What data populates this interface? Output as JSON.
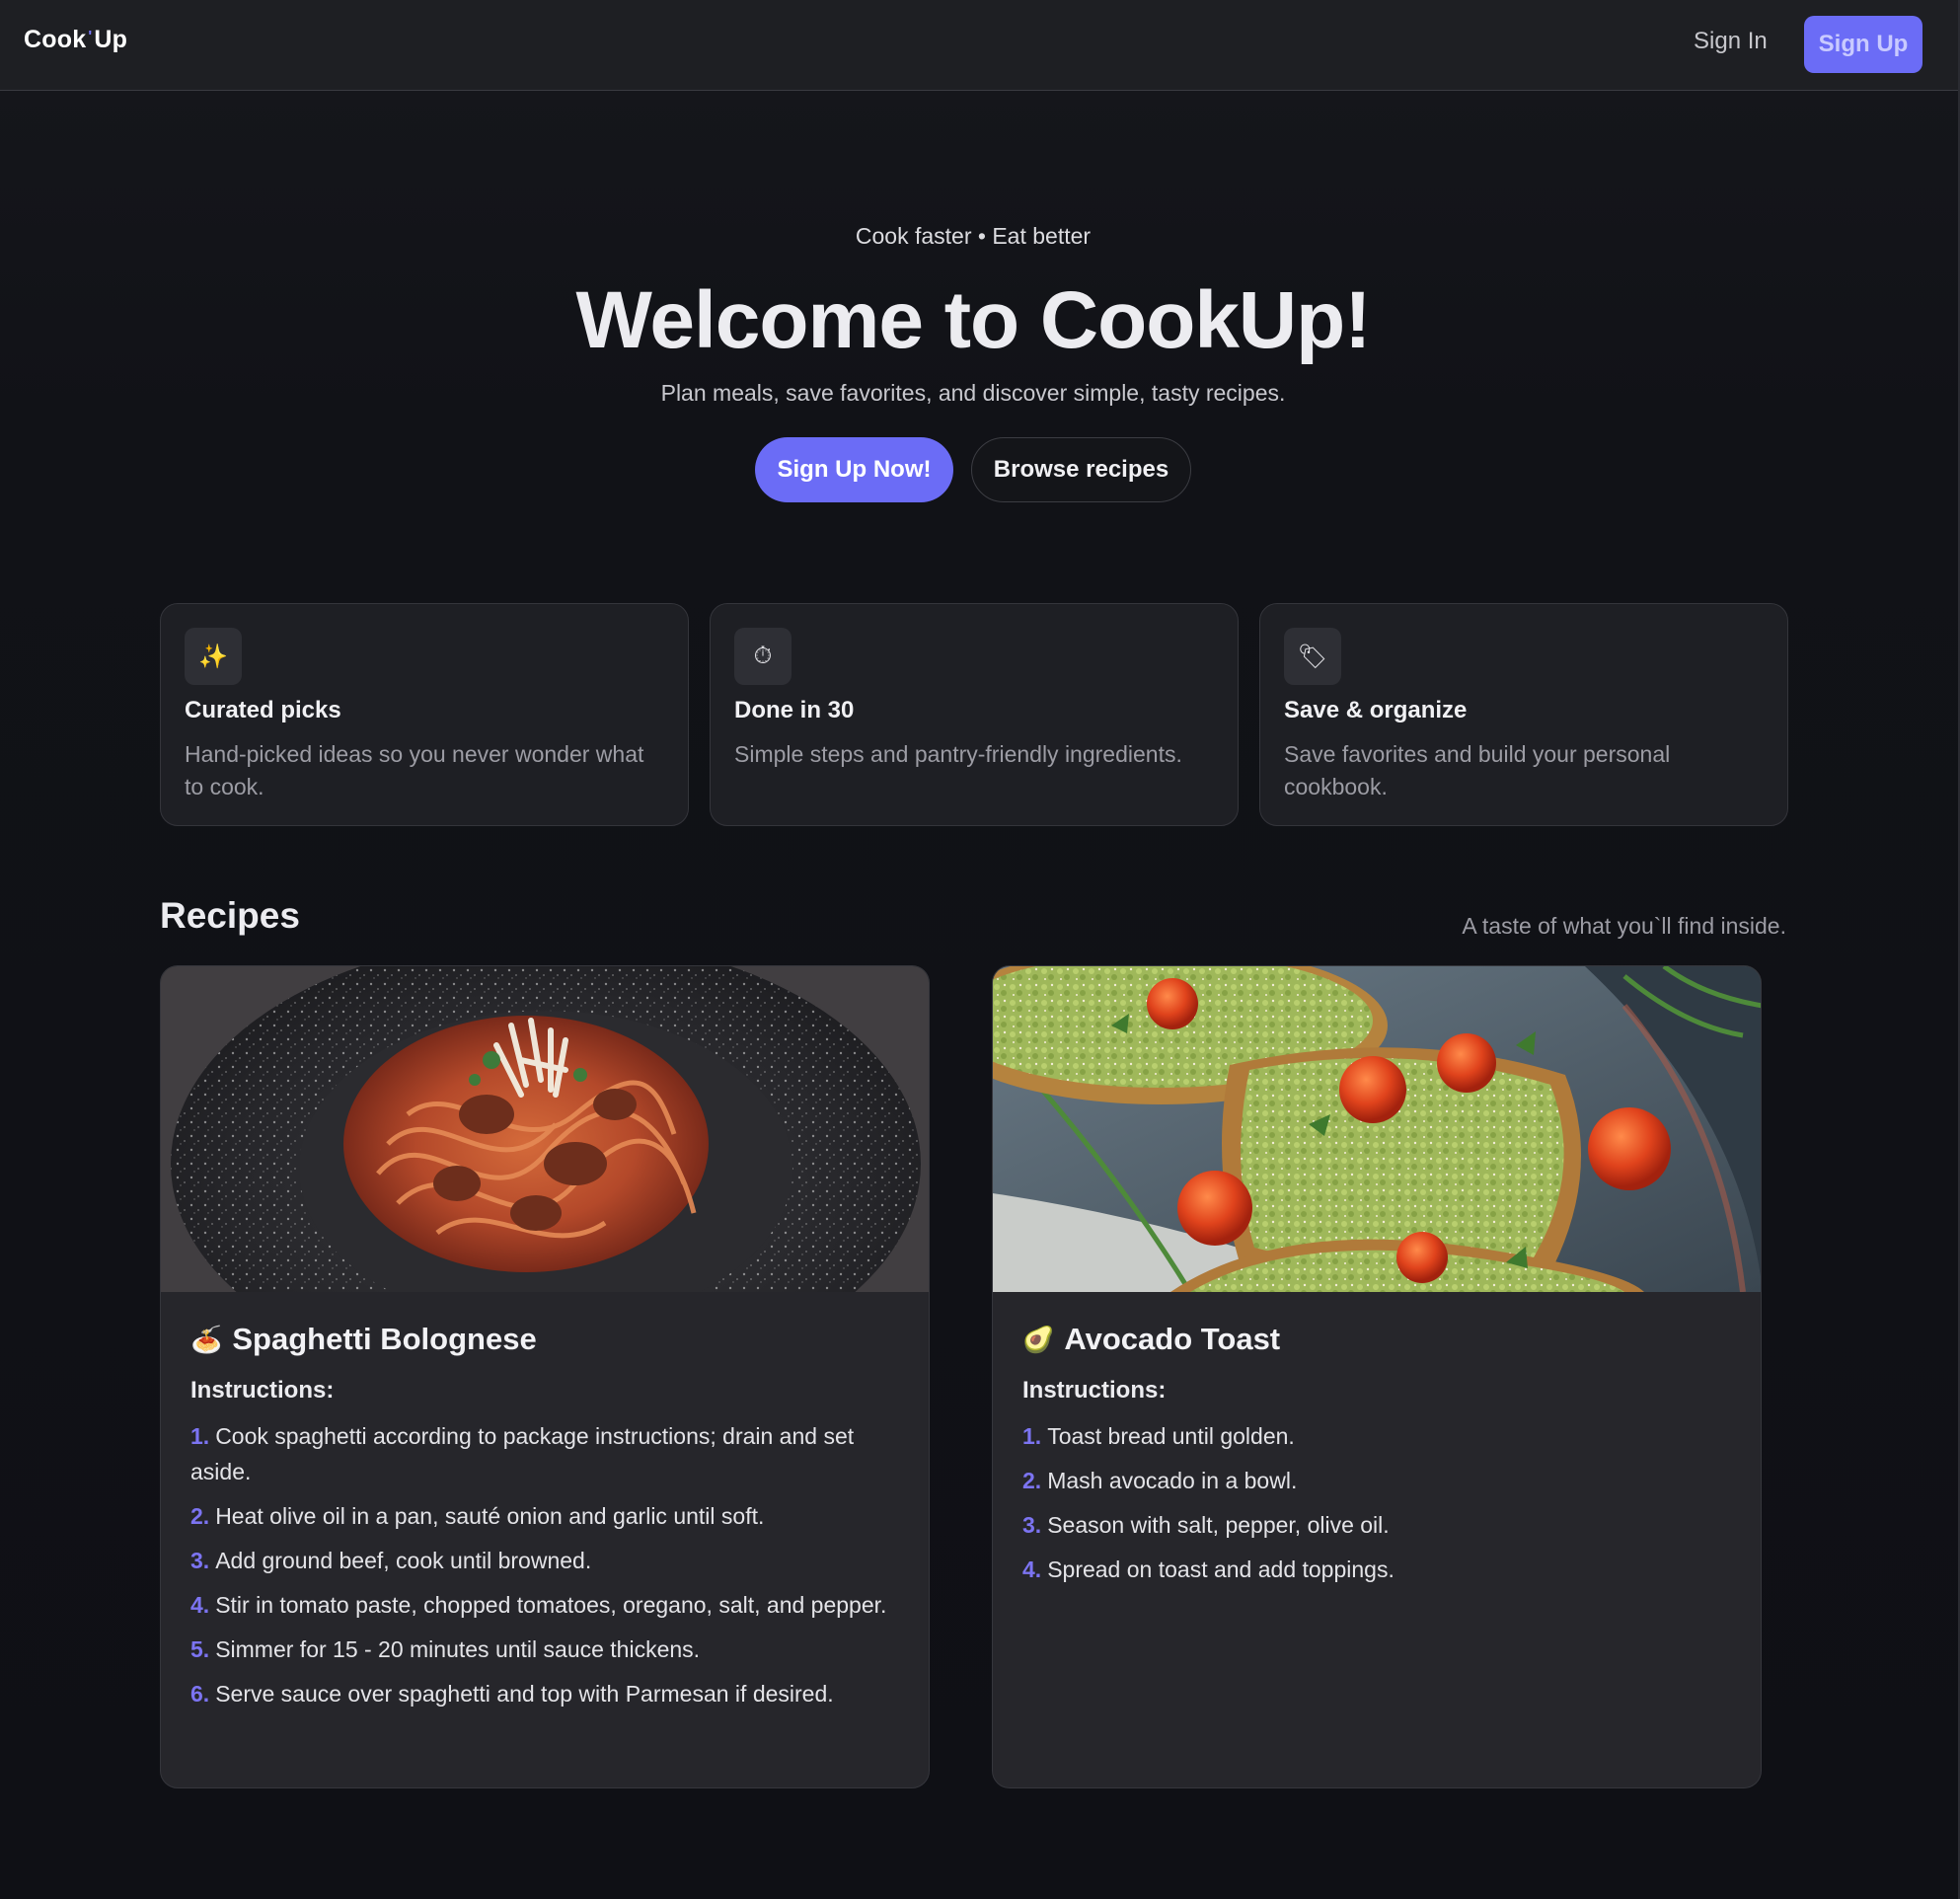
{
  "nav": {
    "logo_left": "Cook",
    "logo_mark": "'",
    "logo_right": "Up",
    "sign_in": "Sign In",
    "sign_up": "Sign Up"
  },
  "hero": {
    "eyebrow": "Cook faster • Eat better",
    "title": "Welcome to CookUp!",
    "subtitle": "Plan meals, save favorites, and discover simple, tasty recipes.",
    "primary_cta": "Sign Up Now!",
    "secondary_cta": "Browse recipes"
  },
  "features": [
    {
      "icon": "sparkles-icon",
      "glyph": "✨",
      "title": "Curated picks",
      "desc": "Hand-picked ideas so you never wonder what to cook."
    },
    {
      "icon": "stopwatch-icon",
      "glyph": "⏱",
      "title": "Done in 30",
      "desc": "Simple steps and pantry-friendly ingredients."
    },
    {
      "icon": "bookmark-tag-icon",
      "glyph": "🏷",
      "title": "Save & organize",
      "desc": "Save favorites and build your personal cookbook."
    }
  ],
  "recipes_section": {
    "title": "Recipes",
    "note": "A taste of what you`ll find inside."
  },
  "recipes": [
    {
      "emoji": "🍝",
      "title": "Spaghetti Bolognese",
      "instructions_label": "Instructions:",
      "steps": [
        "Cook spaghetti according to package instructions; drain and set aside.",
        "Heat olive oil in a pan, sauté onion and garlic until soft.",
        "Add ground beef, cook until browned.",
        "Stir in tomato paste, chopped tomatoes, oregano, salt, and pepper.",
        "Simmer for 15 - 20 minutes until sauce thickens.",
        "Serve sauce over spaghetti and top with Parmesan if desired."
      ]
    },
    {
      "emoji": "🥑",
      "title": "Avocado Toast",
      "instructions_label": "Instructions:",
      "steps": [
        "Toast bread until golden.",
        "Mash avocado in a bowl.",
        "Season with salt, pepper, olive oil.",
        "Spread on toast and add toppings."
      ]
    }
  ],
  "colors": {
    "accent": "#6b6cf6",
    "step_number": "#7c74f2",
    "background": "#101116",
    "card": "#1e1f24"
  }
}
